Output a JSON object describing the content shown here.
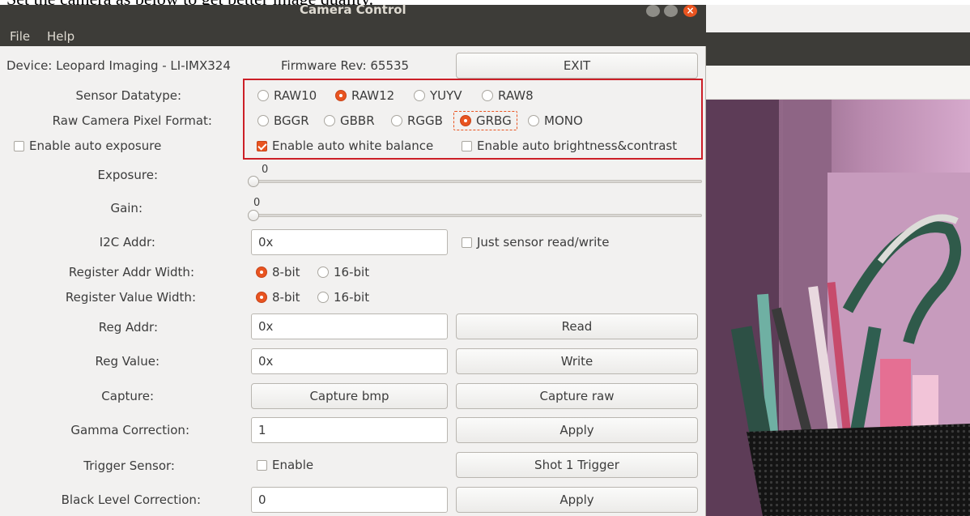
{
  "doc_text": "Set the camera as below to get better image quality.",
  "window": {
    "title": "Camera Control"
  },
  "menu": {
    "file": "File",
    "help": "Help"
  },
  "device": {
    "label": "Device: Leopard Imaging - LI-IMX324",
    "firmware": "Firmware Rev: 65535",
    "exit": "EXIT"
  },
  "sensor_datatype": {
    "label": "Sensor Datatype:",
    "options": [
      "RAW10",
      "RAW12",
      "YUYV",
      "RAW8"
    ],
    "selected": "RAW12"
  },
  "pixel_format": {
    "label": "Raw Camera Pixel Format:",
    "options": [
      "BGGR",
      "GBBR",
      "RGGB",
      "GRBG",
      "MONO"
    ],
    "selected": "GRBG"
  },
  "auto_exposure": {
    "label": "Enable auto exposure",
    "checked": false
  },
  "auto_white_balance": {
    "label": "Enable auto white balance",
    "checked": true
  },
  "auto_brightness": {
    "label": "Enable auto brightness&contrast",
    "checked": false
  },
  "exposure": {
    "label": "Exposure:",
    "value": "0"
  },
  "gain": {
    "label": "Gain:",
    "value": "0"
  },
  "i2c": {
    "label": "I2C Addr:",
    "value": "0x",
    "just_sensor": "Just sensor read/write"
  },
  "reg_addr_width": {
    "label": "Register Addr Width:",
    "opt1": "8-bit",
    "opt2": "16-bit",
    "selected": "8-bit"
  },
  "reg_value_width": {
    "label": "Register Value Width:",
    "opt1": "8-bit",
    "opt2": "16-bit",
    "selected": "8-bit"
  },
  "reg_addr": {
    "label": "Reg Addr:",
    "value": "0x",
    "button": "Read"
  },
  "reg_value": {
    "label": "Reg Value:",
    "value": "0x",
    "button": "Write"
  },
  "capture": {
    "label": "Capture:",
    "bmp": "Capture bmp",
    "raw": "Capture raw"
  },
  "gamma": {
    "label": "Gamma Correction:",
    "value": "1",
    "button": "Apply"
  },
  "trigger": {
    "label": "Trigger Sensor:",
    "enable": "Enable",
    "enabled": false,
    "button": "Shot 1 Trigger"
  },
  "black_level": {
    "label": "Black Level Correction:",
    "value": "0",
    "button": "Apply"
  },
  "colors": {
    "accent": "#e95420",
    "titlebar": "#3d3c38",
    "highlight_box": "#cc1f27"
  }
}
